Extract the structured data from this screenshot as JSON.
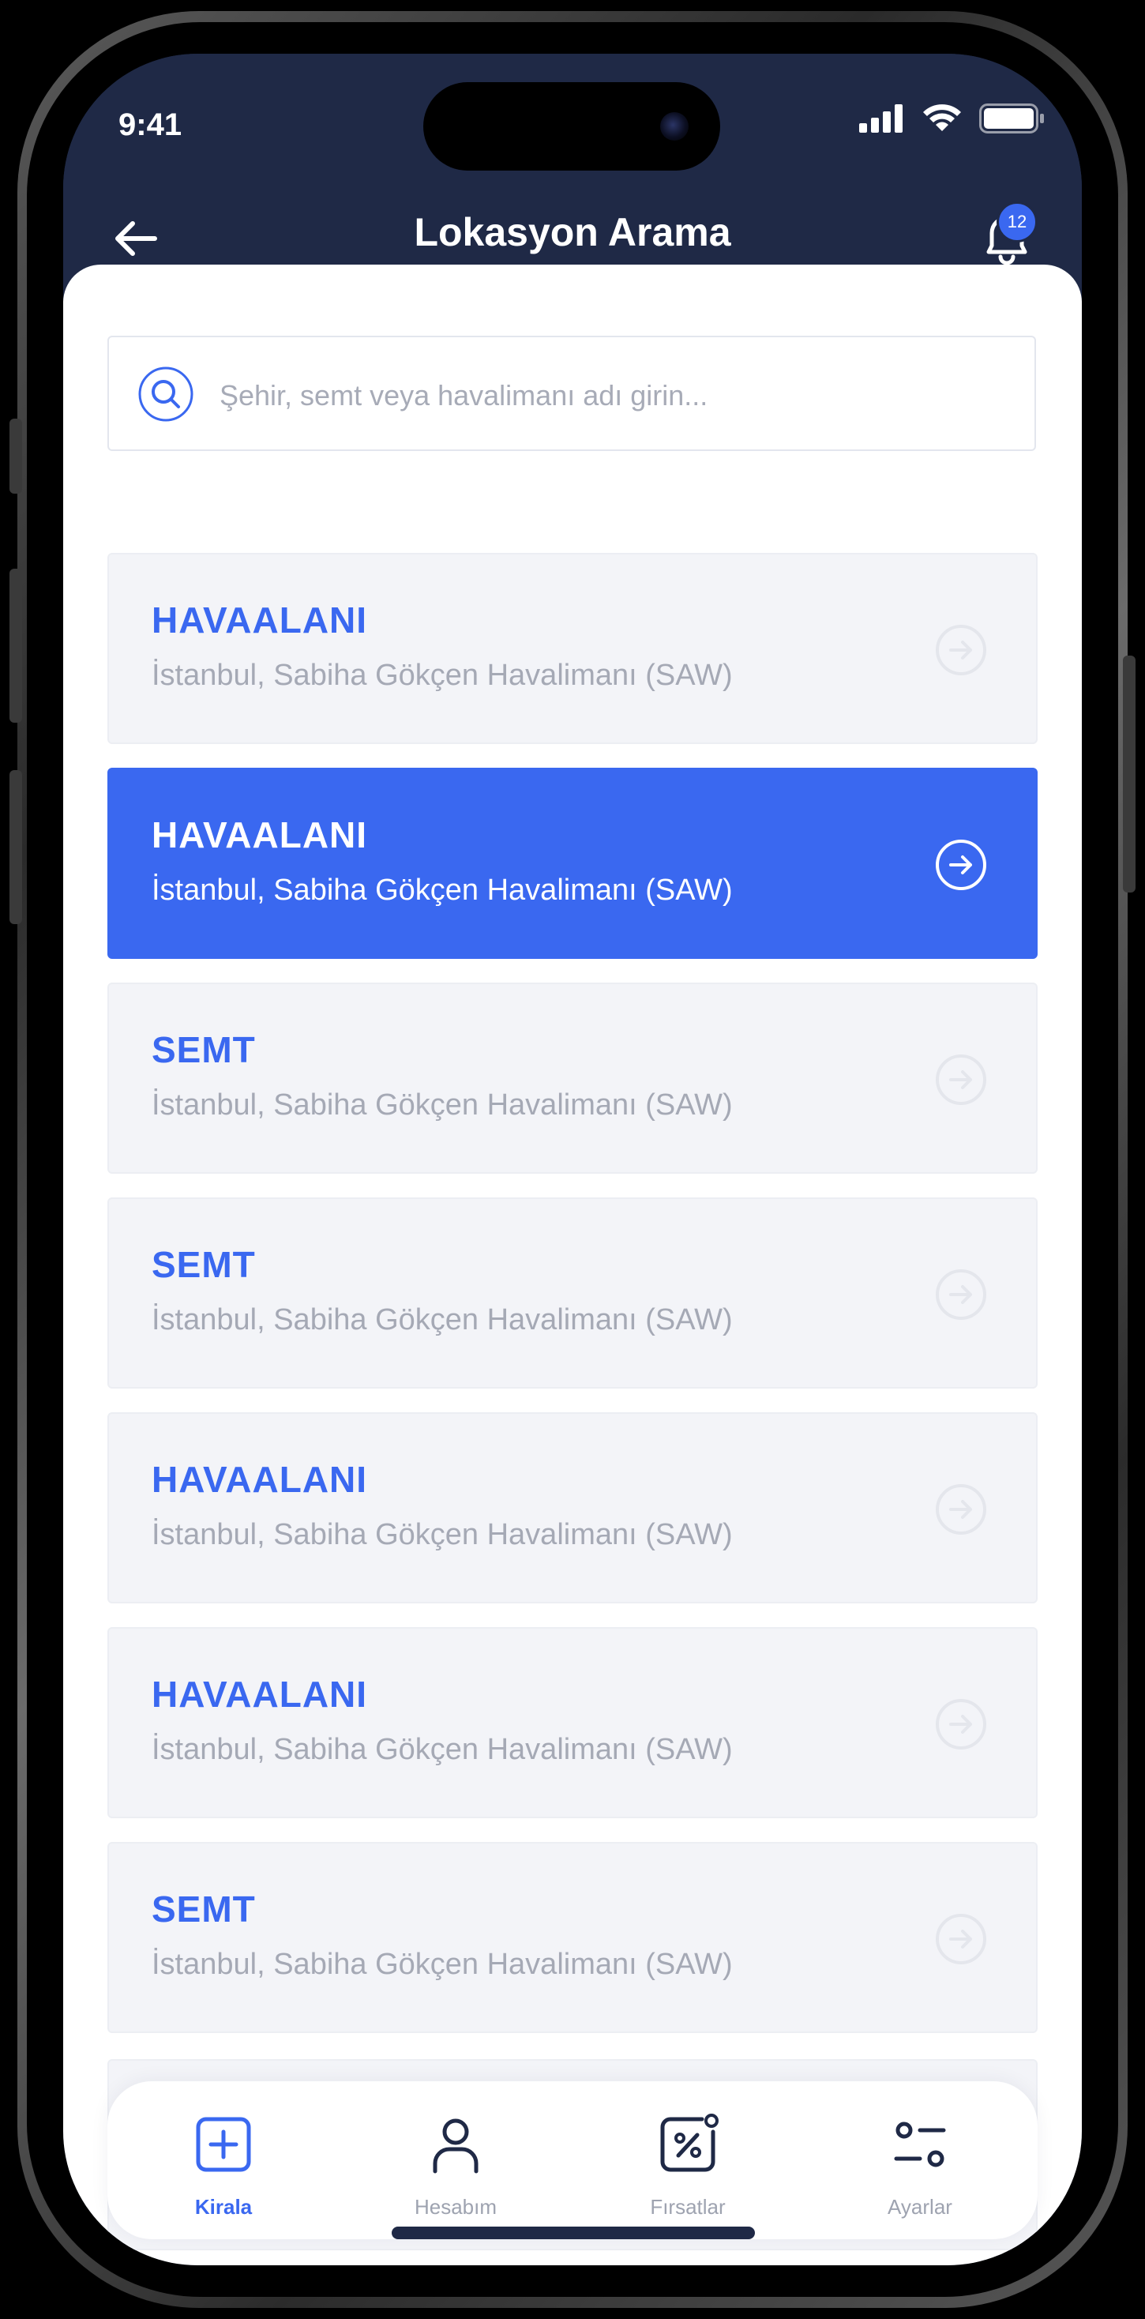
{
  "status": {
    "time": "9:41"
  },
  "header": {
    "title": "Lokasyon Arama",
    "notification_count": "12"
  },
  "search": {
    "placeholder": "Şehir, semt veya havalimanı adı girin..."
  },
  "locations": [
    {
      "type": "HAVAALANI",
      "name": "İstanbul, Sabiha Gökçen Havalimanı (SAW)",
      "selected": false
    },
    {
      "type": "HAVAALANI",
      "name": "İstanbul, Sabiha Gökçen Havalimanı (SAW)",
      "selected": true
    },
    {
      "type": "SEMT",
      "name": "İstanbul, Sabiha Gökçen Havalimanı (SAW)",
      "selected": false
    },
    {
      "type": "SEMT",
      "name": "İstanbul, Sabiha Gökçen Havalimanı (SAW)",
      "selected": false
    },
    {
      "type": "HAVAALANI",
      "name": "İstanbul, Sabiha Gökçen Havalimanı (SAW)",
      "selected": false
    },
    {
      "type": "HAVAALANI",
      "name": "İstanbul, Sabiha Gökçen Havalimanı (SAW)",
      "selected": false
    },
    {
      "type": "SEMT",
      "name": "İstanbul, Sabiha Gökçen Havalimanı (SAW)",
      "selected": false
    }
  ],
  "tabs": [
    {
      "label": "Kirala",
      "icon": "plus-square-icon",
      "active": true
    },
    {
      "label": "Hesabım",
      "icon": "user-icon",
      "active": false
    },
    {
      "label": "Fırsatlar",
      "icon": "percent-icon",
      "active": false
    },
    {
      "label": "Ayarlar",
      "icon": "settings-sliders-icon",
      "active": false
    }
  ],
  "colors": {
    "accent": "#3a68f0",
    "header_bg": "#1f2946",
    "item_bg": "#f3f4f8",
    "muted_text": "#a5a9b5"
  }
}
